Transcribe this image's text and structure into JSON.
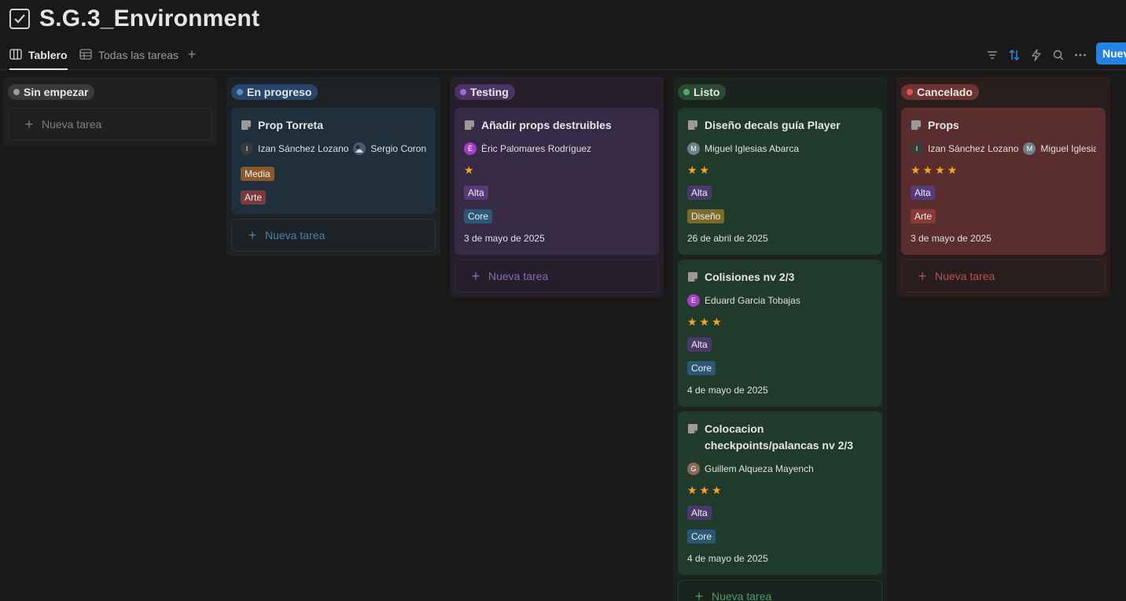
{
  "page": {
    "title": "S.G.3_Environment"
  },
  "views": [
    {
      "label": "Tablero",
      "icon": "board-icon",
      "active": true
    },
    {
      "label": "Todas las tareas",
      "icon": "table-icon",
      "active": false
    }
  ],
  "toolbar": {
    "icons": [
      "filter-icon",
      "sort-icon",
      "automation-icon",
      "search-icon",
      "more-icon"
    ],
    "new_label": "Nuevo"
  },
  "new_task_label": "Nueva tarea",
  "columns": [
    {
      "name": "Sin empezar",
      "colors": {
        "bg": "#202020",
        "pill": "#3a3a3a",
        "dot": "#9b9b9b",
        "card": "#2a2a2a",
        "new_text": "#7f7f7f",
        "new_border": "#2e2e2e"
      },
      "cards": []
    },
    {
      "name": "En progreso",
      "colors": {
        "bg": "#1c2226",
        "pill": "#28456c",
        "dot": "#5591c4",
        "card": "#1f2f3b",
        "new_text": "#4f7fa3",
        "new_border": "#263541"
      },
      "cards": [
        {
          "title": "Prop Torreta",
          "people": [
            {
              "initial": "I",
              "name": "Izan Sánchez Lozano",
              "avatar_color": "#3b3b3b"
            },
            {
              "initial": "",
              "name": "Sergio Corona",
              "avatar_color": "#5b6f86"
            }
          ],
          "stars": "",
          "tags": [
            {
              "text": "Media",
              "color": "#8a5a2b"
            },
            {
              "text": "Arte",
              "color": "#7a3a3f"
            }
          ],
          "date": ""
        }
      ]
    },
    {
      "name": "Testing",
      "colors": {
        "bg": "#241f2a",
        "pill": "#4b3463",
        "dot": "#a26ad3",
        "card": "#372a45",
        "new_text": "#9168b5",
        "new_border": "#332a3d"
      },
      "cards": [
        {
          "title": "Añadir props destruibles",
          "people": [
            {
              "initial": "È",
              "name": "Èric Palomares Rodríguez",
              "avatar_color": "#a53fc2"
            }
          ],
          "stars": "★",
          "tags": [
            {
              "text": "Alta",
              "color": "#573b78"
            },
            {
              "text": "Core",
              "color": "#2b5777"
            }
          ],
          "date": "3 de mayo de 2025"
        }
      ]
    },
    {
      "name": "Listo",
      "colors": {
        "bg": "#1b231e",
        "pill": "#2a4a34",
        "dot": "#4dab6d",
        "card": "#203a2b",
        "new_text": "#4f9a66",
        "new_border": "#26392c"
      },
      "cards": [
        {
          "title": "Diseño decals guía Player",
          "people": [
            {
              "initial": "M",
              "name": "Miguel Iglesias Abarca",
              "avatar_color": "#6f7f8a"
            }
          ],
          "stars": "★★",
          "tags": [
            {
              "text": "Alta",
              "color": "#4a3a6b"
            },
            {
              "text": "Diseño",
              "color": "#7a6a2b"
            }
          ],
          "date": "26 de abril de 2025"
        },
        {
          "title": "Colisiones nv 2/3",
          "people": [
            {
              "initial": "E",
              "name": "Eduard Garcia Tobajas",
              "avatar_color": "#a53fc2"
            }
          ],
          "stars": "★★★",
          "tags": [
            {
              "text": "Alta",
              "color": "#4a3a6b"
            },
            {
              "text": "Core",
              "color": "#2b5777"
            }
          ],
          "date": "4 de mayo de 2025"
        },
        {
          "title": "Colocacion checkpoints/palancas nv 2/3",
          "people": [
            {
              "initial": "G",
              "name": "Guillem Alqueza Mayench",
              "avatar_color": "#8a6a5a"
            }
          ],
          "stars": "★★★",
          "tags": [
            {
              "text": "Alta",
              "color": "#4a3a6b"
            },
            {
              "text": "Core",
              "color": "#2b5777"
            }
          ],
          "date": "4 de mayo de 2025"
        }
      ]
    },
    {
      "name": "Cancelado",
      "colors": {
        "bg": "#2a1d1d",
        "pill": "#6e3434",
        "dot": "#e55454",
        "card": "#5a2e2e",
        "new_text": "#b25555",
        "new_border": "#3d2727"
      },
      "cards": [
        {
          "title": "Props",
          "people": [
            {
              "initial": "I",
              "name": "Izan Sánchez Lozano",
              "avatar_color": "#3b3b3b"
            },
            {
              "initial": "M",
              "name": "Miguel Iglesias Abarca",
              "avatar_color": "#6f7f8a"
            }
          ],
          "stars": "★★★★",
          "tags": [
            {
              "text": "Alta",
              "color": "#573b78"
            },
            {
              "text": "Arte",
              "color": "#8a3a35"
            }
          ],
          "date": "3 de mayo de 2025"
        }
      ]
    }
  ]
}
